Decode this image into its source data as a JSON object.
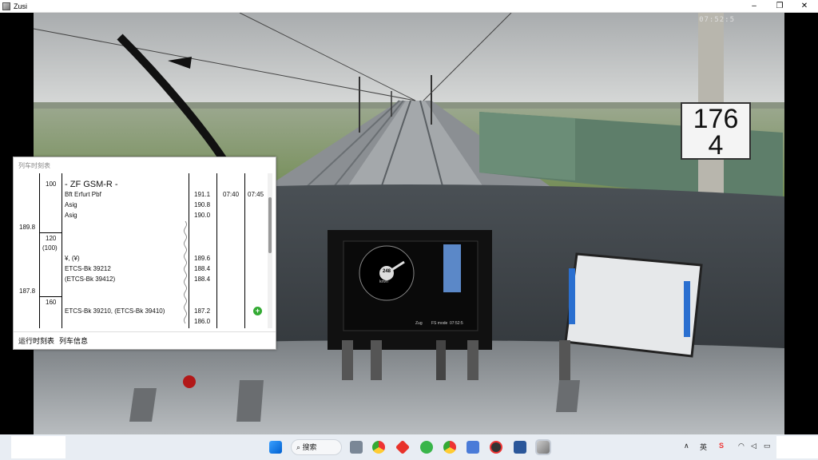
{
  "window": {
    "title": "Zusi",
    "minimize": "–",
    "restore": "❐",
    "close": "✕",
    "clock": "07:52:5"
  },
  "sign": {
    "top": "176",
    "bottom": "4"
  },
  "timetable": {
    "header": "列车时刻表",
    "track_name": "- ZF GSM-R -",
    "speed_rows": [
      {
        "label": "100"
      },
      {
        "label": "120"
      },
      {
        "label": "(100)"
      },
      {
        "label": "160"
      }
    ],
    "km_marks": [
      "189.8",
      "187.8"
    ],
    "rows": [
      {
        "name": "Bft Erfurt Pbf",
        "km": "191.1",
        "arr": "07:40",
        "dep": "07:45"
      },
      {
        "name": "Asig",
        "km": "190.8",
        "arr": "",
        "dep": ""
      },
      {
        "name": "Asig",
        "km": "190.0",
        "arr": "",
        "dep": ""
      },
      {
        "name": "¥, (¥)",
        "km": "189.6",
        "arr": "",
        "dep": ""
      },
      {
        "name": "ETCS-Bk 39212",
        "km": "188.4",
        "arr": "",
        "dep": ""
      },
      {
        "name": "(ETCS-Bk 39412)",
        "km": "188.4",
        "arr": "",
        "dep": ""
      },
      {
        "name": "ETCS-Bk 39210, (ETCS-Bk 39410)",
        "km": "187.2",
        "arr": "",
        "dep": ""
      },
      {
        "name": "",
        "km": "186.0",
        "arr": "",
        "dep": ""
      }
    ],
    "plus_button": "+",
    "tabs": [
      "运行时刻表",
      "列车信息"
    ]
  },
  "dmi": {
    "speed": "248",
    "unit": "km/h",
    "bottom_labels": [
      "Zug",
      "FS mode",
      "07:52:5"
    ]
  },
  "taskbar": {
    "search_label": "搜索",
    "tray_up": "∧",
    "ime": "英",
    "apps": [
      "windows-start",
      "file-explorer",
      "chrome",
      "app-red",
      "app-green",
      "chrome-2",
      "app-blue",
      "app-red-2",
      "word",
      "zusi"
    ]
  }
}
